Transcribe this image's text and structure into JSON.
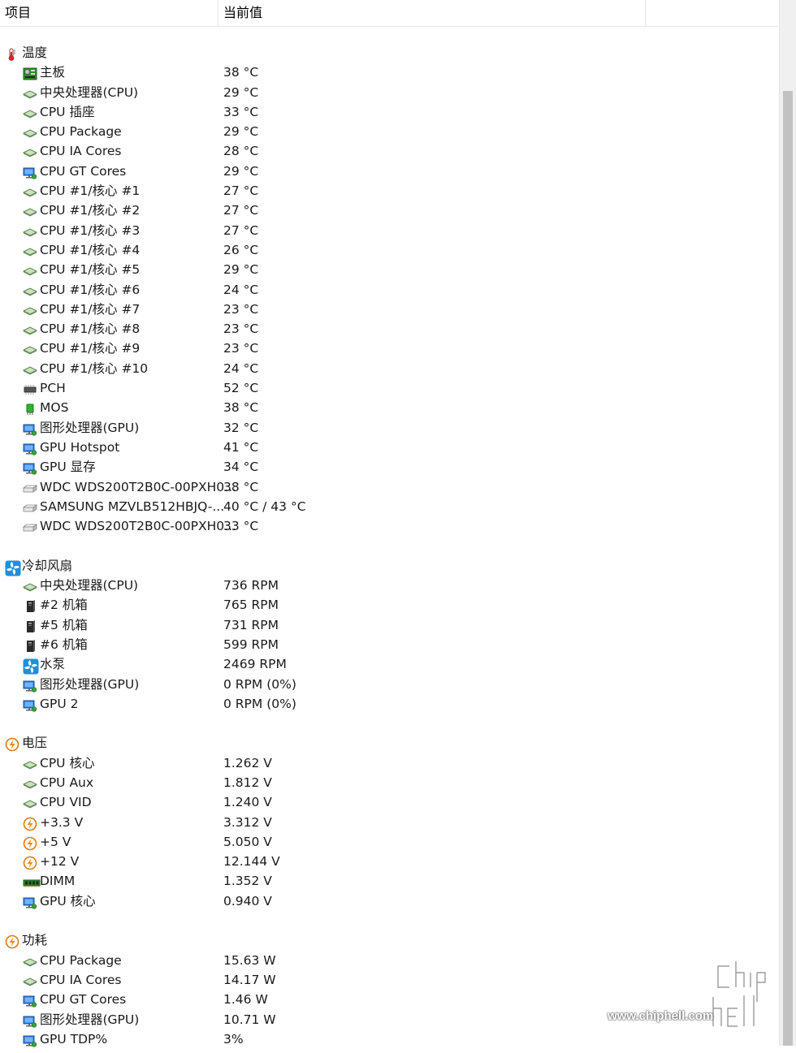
{
  "header": {
    "col_item": "项目",
    "col_value": "当前值"
  },
  "categories": [
    {
      "name": "温度",
      "icon": "thermometer-icon",
      "items": [
        {
          "label": "主板",
          "value": "38 °C",
          "icon": "motherboard-icon"
        },
        {
          "label": "中央处理器(CPU)",
          "value": "29 °C",
          "icon": "cpu-icon"
        },
        {
          "label": "CPU 插座",
          "value": "33 °C",
          "icon": "cpu-icon"
        },
        {
          "label": "CPU Package",
          "value": "29 °C",
          "icon": "cpu-icon"
        },
        {
          "label": "CPU IA Cores",
          "value": "28 °C",
          "icon": "cpu-icon"
        },
        {
          "label": "CPU GT Cores",
          "value": "29 °C",
          "icon": "monitor-icon"
        },
        {
          "label": "CPU #1/核心 #1",
          "value": "27 °C",
          "icon": "cpu-icon"
        },
        {
          "label": "CPU #1/核心 #2",
          "value": "27 °C",
          "icon": "cpu-icon"
        },
        {
          "label": "CPU #1/核心 #3",
          "value": "27 °C",
          "icon": "cpu-icon"
        },
        {
          "label": "CPU #1/核心 #4",
          "value": "26 °C",
          "icon": "cpu-icon"
        },
        {
          "label": "CPU #1/核心 #5",
          "value": "29 °C",
          "icon": "cpu-icon"
        },
        {
          "label": "CPU #1/核心 #6",
          "value": "24 °C",
          "icon": "cpu-icon"
        },
        {
          "label": "CPU #1/核心 #7",
          "value": "23 °C",
          "icon": "cpu-icon"
        },
        {
          "label": "CPU #1/核心 #8",
          "value": "23 °C",
          "icon": "cpu-icon"
        },
        {
          "label": "CPU #1/核心 #9",
          "value": "23 °C",
          "icon": "cpu-icon"
        },
        {
          "label": "CPU #1/核心 #10",
          "value": "24 °C",
          "icon": "cpu-icon"
        },
        {
          "label": "PCH",
          "value": "52 °C",
          "icon": "chip-icon"
        },
        {
          "label": "MOS",
          "value": "38 °C",
          "icon": "mos-icon"
        },
        {
          "label": "图形处理器(GPU)",
          "value": "32 °C",
          "icon": "monitor-icon"
        },
        {
          "label": "GPU Hotspot",
          "value": "41 °C",
          "icon": "monitor-icon"
        },
        {
          "label": "GPU 显存",
          "value": "34 °C",
          "icon": "monitor-icon"
        },
        {
          "label": "WDC WDS200T2B0C-00PXH0...",
          "value": "38 °C",
          "icon": "drive-icon"
        },
        {
          "label": "SAMSUNG MZVLB512HBJQ-...",
          "value": "40 °C / 43 °C",
          "icon": "drive-icon"
        },
        {
          "label": "WDC WDS200T2B0C-00PXH0...",
          "value": "33 °C",
          "icon": "drive-icon"
        }
      ]
    },
    {
      "name": "冷却风扇",
      "icon": "fan-icon",
      "items": [
        {
          "label": "中央处理器(CPU)",
          "value": "736 RPM",
          "icon": "cpu-icon"
        },
        {
          "label": "#2 机箱",
          "value": "765 RPM",
          "icon": "case-icon"
        },
        {
          "label": "#5 机箱",
          "value": "731 RPM",
          "icon": "case-icon"
        },
        {
          "label": "#6 机箱",
          "value": "599 RPM",
          "icon": "case-icon"
        },
        {
          "label": "水泵",
          "value": "2469 RPM",
          "icon": "fan-icon"
        },
        {
          "label": "图形处理器(GPU)",
          "value": "0 RPM  (0%)",
          "icon": "monitor-icon"
        },
        {
          "label": "GPU 2",
          "value": "0 RPM  (0%)",
          "icon": "monitor-icon"
        }
      ]
    },
    {
      "name": "电压",
      "icon": "bolt-icon",
      "items": [
        {
          "label": "CPU 核心",
          "value": "1.262 V",
          "icon": "cpu-icon"
        },
        {
          "label": "CPU Aux",
          "value": "1.812 V",
          "icon": "cpu-icon"
        },
        {
          "label": "CPU VID",
          "value": "1.240 V",
          "icon": "cpu-icon"
        },
        {
          "label": "+3.3 V",
          "value": "3.312 V",
          "icon": "bolt-icon"
        },
        {
          "label": "+5 V",
          "value": "5.050 V",
          "icon": "bolt-icon"
        },
        {
          "label": "+12 V",
          "value": "12.144 V",
          "icon": "bolt-icon"
        },
        {
          "label": "DIMM",
          "value": "1.352 V",
          "icon": "ram-icon"
        },
        {
          "label": "GPU 核心",
          "value": "0.940 V",
          "icon": "monitor-icon"
        }
      ]
    },
    {
      "name": "功耗",
      "icon": "bolt-icon",
      "items": [
        {
          "label": "CPU Package",
          "value": "15.63 W",
          "icon": "cpu-icon"
        },
        {
          "label": "CPU IA Cores",
          "value": "14.17 W",
          "icon": "cpu-icon"
        },
        {
          "label": "CPU GT Cores",
          "value": "1.46 W",
          "icon": "monitor-icon"
        },
        {
          "label": "图形处理器(GPU)",
          "value": "10.71 W",
          "icon": "monitor-icon"
        },
        {
          "label": "GPU TDP%",
          "value": "3%",
          "icon": "monitor-icon"
        }
      ]
    }
  ],
  "watermark": {
    "url": "www.chiphell.com",
    "logo_text": "chip hell"
  }
}
